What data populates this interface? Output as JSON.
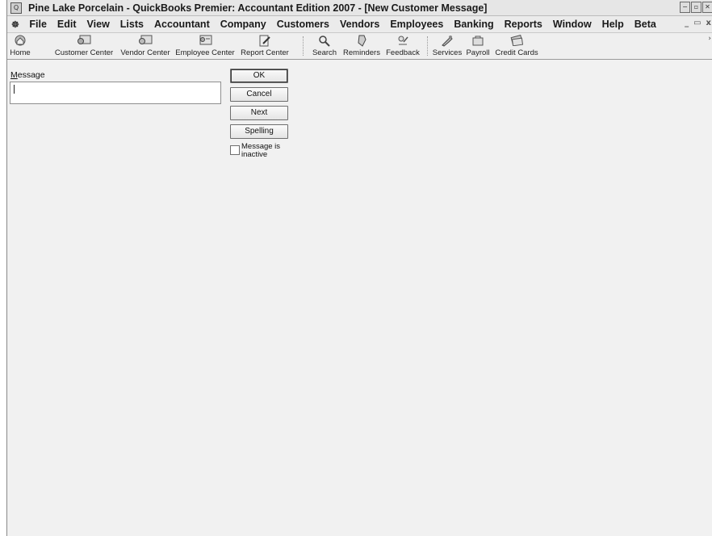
{
  "window": {
    "title": "Pine Lake Porcelain - QuickBooks Premier: Accountant Edition 2007 - [New Customer Message]",
    "controls": {
      "minimize": "−",
      "restore": "▫",
      "close": "✕"
    }
  },
  "menubar": {
    "items": [
      "File",
      "Edit",
      "View",
      "Lists",
      "Accountant",
      "Company",
      "Customers",
      "Vendors",
      "Employees",
      "Banking",
      "Reports",
      "Window",
      "Help",
      "Beta"
    ],
    "mdi_controls": {
      "minimize": "_",
      "restore": "▭",
      "close": "x"
    }
  },
  "toolbar": {
    "buttons": [
      {
        "label": "Home",
        "icon": "home-icon"
      },
      {
        "label": "Customer Center",
        "icon": "customer-center-icon"
      },
      {
        "label": "Vendor Center",
        "icon": "vendor-center-icon"
      },
      {
        "label": "Employee Center",
        "icon": "employee-center-icon"
      },
      {
        "label": "Report Center",
        "icon": "report-center-icon"
      },
      {
        "label": "Search",
        "icon": "search-icon"
      },
      {
        "label": "Reminders",
        "icon": "reminders-icon"
      },
      {
        "label": "Feedback",
        "icon": "feedback-icon"
      },
      {
        "label": "Services",
        "icon": "services-icon"
      },
      {
        "label": "Payroll",
        "icon": "payroll-icon"
      },
      {
        "label": "Credit Cards",
        "icon": "credit-cards-icon"
      }
    ],
    "more": "›"
  },
  "form": {
    "message_label_first": "M",
    "message_label_rest": "essage",
    "message_value": "",
    "buttons": {
      "ok": "OK",
      "cancel": "Cancel",
      "next": "Next",
      "spelling": "Spelling"
    },
    "inactive_checkbox": {
      "label": "Message is inactive",
      "checked": false
    }
  }
}
